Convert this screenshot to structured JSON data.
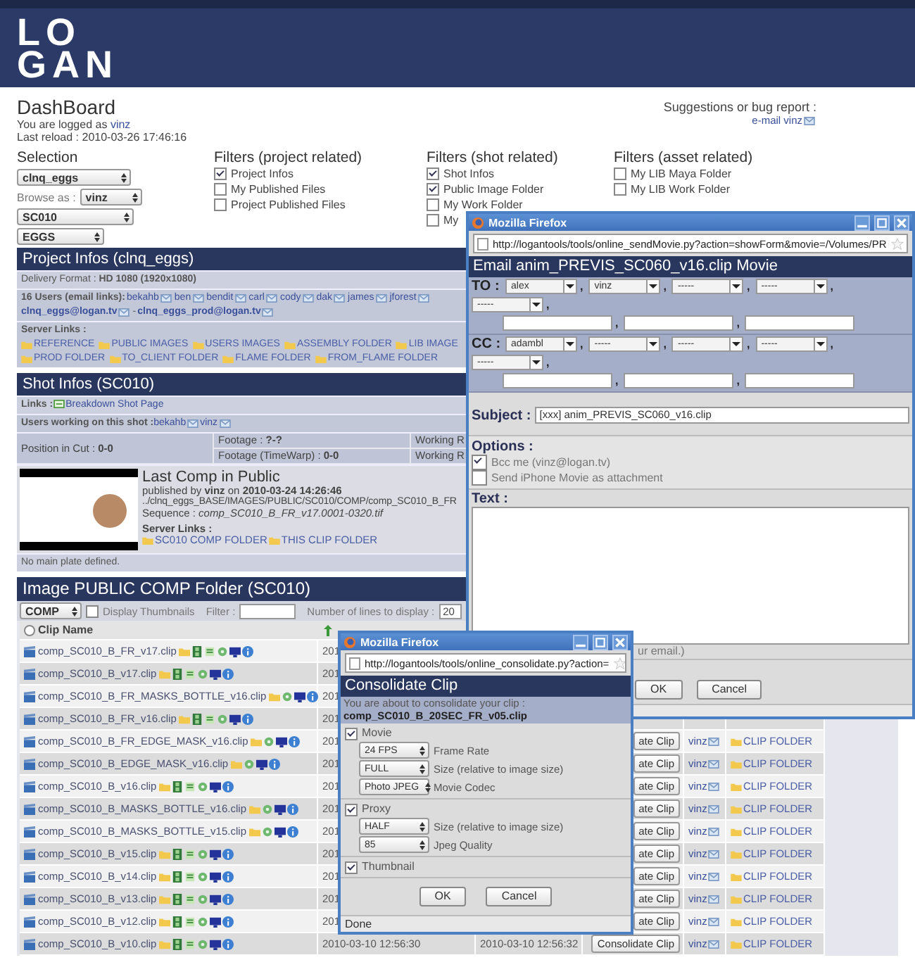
{
  "header": {
    "logo_lines": [
      "LO",
      "GAN"
    ]
  },
  "page": {
    "title": "DashBoard",
    "logged_as_label": "You are logged as",
    "user": "vinz",
    "last_reload": "Last reload : 2010-03-26 17:46:16",
    "suggestions": "Suggestions or bug report :",
    "email_link": "e-mail vinz"
  },
  "selection": {
    "title": "Selection",
    "project": "clnq_eggs",
    "browse_as_label": "Browse as :",
    "browse_as": "vinz",
    "shot": "SC010",
    "asset": "EGGS"
  },
  "filter_groups": [
    {
      "title": "Filters (project related)",
      "items": [
        {
          "label": "Project Infos",
          "checked": true
        },
        {
          "label": "My Published Files",
          "checked": false
        },
        {
          "label": "Project Published Files",
          "checked": false
        }
      ]
    },
    {
      "title": "Filters (shot related)",
      "items": [
        {
          "label": "Shot Infos",
          "checked": true
        },
        {
          "label": "Public Image Folder",
          "checked": true
        },
        {
          "label": "My Work Folder",
          "checked": false
        },
        {
          "label": "My",
          "checked": false
        }
      ]
    },
    {
      "title": "Filters (asset related)",
      "items": [
        {
          "label": "My LIB Maya Folder",
          "checked": false
        },
        {
          "label": "My LIB Work Folder",
          "checked": false
        }
      ]
    }
  ],
  "project_infos": {
    "title": "Project Infos (clnq_eggs)",
    "delivery_label": "Delivery Format :",
    "delivery": "HD 1080 (1920x1080)",
    "users_label": "16 Users (email links):",
    "users": [
      "bekahb",
      "ben",
      "bendit",
      "carl",
      "cody",
      "dak",
      "james",
      "jforest"
    ],
    "lists": [
      "clnq_eggs@logan.tv",
      "clnq_eggs_prod@logan.tv"
    ],
    "separator": "-",
    "server_links_label": "Server Links :",
    "links": [
      "REFERENCE",
      "PUBLIC IMAGES",
      "USERS IMAGES",
      "ASSEMBLY FOLDER",
      "LIB IMAGE",
      "PROD FOLDER",
      "TO_CLIENT FOLDER",
      "FLAME FOLDER",
      "FROM_FLAME FOLDER"
    ]
  },
  "shot_infos": {
    "title": "Shot Infos (SC010)",
    "links_label": "Links :",
    "breakdown_link": "Breakdown Shot Page",
    "users_label": "Users working on this shot :",
    "users": [
      "bekahb",
      "vinz"
    ],
    "position": "Position in Cut : **0-0**",
    "footage": "Footage : **?-?**",
    "footage_timewarp": "Footage (TimeWarp) : **0-0**",
    "working": [
      "Working R",
      "Working R"
    ],
    "last_comp_title": "Last Comp in Public",
    "published": "published by **vinz** on **2010-03-24 14:26:46**",
    "path": "../clnq_eggs_BASE/IMAGES/PUBLIC/SC010/COMP/comp_SC010_B_FR",
    "sequence": "Sequence : *comp_SC010_B_FR_v17.0001-0320.tif*",
    "server_links_label": "Server Links :",
    "links": [
      "SC010 COMP FOLDER",
      "THIS CLIP FOLDER"
    ],
    "no_plate": "No main plate defined."
  },
  "image_folder": {
    "title": "Image PUBLIC COMP Folder (SC010)",
    "type": "COMP",
    "thumbnails_label": "Display Thumbnails",
    "thumbnails_checked": false,
    "filter_label": "Filter :",
    "lines_label": "Number of lines to display :",
    "lines": "20",
    "columns": [
      "Clip Name"
    ],
    "rows": [
      {
        "name": "comp_SC010_B_FR_v17.clip",
        "has_movie": true,
        "created": "201"
      },
      {
        "name": "comp_SC010_B_v17.clip",
        "has_movie": true,
        "created": "201"
      },
      {
        "name": "comp_SC010_B_FR_MASKS_BOTTLE_v16.clip",
        "has_movie": false,
        "created": "201"
      },
      {
        "name": "comp_SC010_B_FR_v16.clip",
        "has_movie": true,
        "created": "201"
      },
      {
        "name": "comp_SC010_B_FR_EDGE_MASK_v16.clip",
        "has_movie": false,
        "created": "201",
        "action": "ate Clip",
        "user": "vinz",
        "folder": "CLIP FOLDER"
      },
      {
        "name": "comp_SC010_B_EDGE_MASK_v16.clip",
        "has_movie": false,
        "created": "201",
        "action": "ate Clip",
        "user": "vinz",
        "folder": "CLIP FOLDER"
      },
      {
        "name": "comp_SC010_B_v16.clip",
        "has_movie": true,
        "created": "201",
        "action": "ate Clip",
        "user": "vinz",
        "folder": "CLIP FOLDER"
      },
      {
        "name": "comp_SC010_B_MASKS_BOTTLE_v16.clip",
        "has_movie": false,
        "created": "201",
        "action": "ate Clip",
        "user": "vinz",
        "folder": "CLIP FOLDER"
      },
      {
        "name": "comp_SC010_B_MASKS_BOTTLE_v15.clip",
        "has_movie": false,
        "created": "201",
        "action": "ate Clip",
        "user": "vinz",
        "folder": "CLIP FOLDER"
      },
      {
        "name": "comp_SC010_B_v15.clip",
        "has_movie": true,
        "created": "201",
        "action": "ate Clip",
        "user": "vinz",
        "folder": "CLIP FOLDER"
      },
      {
        "name": "comp_SC010_B_v14.clip",
        "has_movie": true,
        "created": "201",
        "action": "ate Clip",
        "user": "vinz",
        "folder": "CLIP FOLDER"
      },
      {
        "name": "comp_SC010_B_v13.clip",
        "has_movie": true,
        "created": "201",
        "action": "ate Clip",
        "user": "vinz",
        "folder": "CLIP FOLDER"
      },
      {
        "name": "comp_SC010_B_v12.clip",
        "has_movie": true,
        "created": "201",
        "action": "ate Clip",
        "user": "vinz",
        "folder": "CLIP FOLDER"
      },
      {
        "name": "comp_SC010_B_v10.clip",
        "has_movie": true,
        "created": "2010-03-10 12:56:30",
        "modified": "2010-03-10 12:56:32",
        "action": "Consolidate Clip",
        "user": "vinz",
        "folder": "CLIP FOLDER"
      }
    ]
  },
  "email_window": {
    "title": "Mozilla Firefox",
    "url": "http://logantools/tools/online_sendMovie.py?action=showForm&movie=/Volumes/PR",
    "heading": "Email anim_PREVIS_SC060_v16.clip Movie",
    "separator": ",",
    "to_label": "TO :",
    "to": [
      "alex",
      "vinz",
      "-----",
      "-----",
      "-----"
    ],
    "cc_label": "CC :",
    "cc": [
      "adambl",
      "-----",
      "-----",
      "-----",
      "-----"
    ],
    "subject_label": "Subject :",
    "subject": "[xxx] anim_PREVIS_SC060_v16.clip",
    "options_label": "Options :",
    "options": [
      {
        "label": "Bcc me (vinz@logan.tv)",
        "checked": true
      },
      {
        "label": "Send iPhone Movie as attachment",
        "checked": false
      }
    ],
    "text_label": "Text :",
    "note": "ur email.)",
    "buttons": [
      "OK",
      "Cancel"
    ]
  },
  "consolidate_window": {
    "title": "Mozilla Firefox",
    "url": "http://logantools/tools/online_consolidate.py?action=",
    "heading": "Consolidate Clip",
    "intro": "You are about to consolidate your clip :",
    "clip": "comp_SC010_B_20SEC_FR_v05.clip",
    "sections": [
      {
        "label": "Movie",
        "checked": true,
        "options": [
          {
            "value": "24 FPS",
            "label": "Frame Rate"
          },
          {
            "value": "FULL",
            "label": "Size (relative to image size)"
          },
          {
            "value": "Photo JPEG",
            "label": "Movie Codec"
          }
        ]
      },
      {
        "label": "Proxy",
        "checked": true,
        "options": [
          {
            "value": "HALF",
            "label": "Size (relative to image size)"
          },
          {
            "value": "85",
            "label": "Jpeg Quality"
          }
        ]
      },
      {
        "label": "Thumbnail",
        "checked": true
      }
    ],
    "buttons": [
      "OK",
      "Cancel"
    ],
    "status": "Done"
  }
}
